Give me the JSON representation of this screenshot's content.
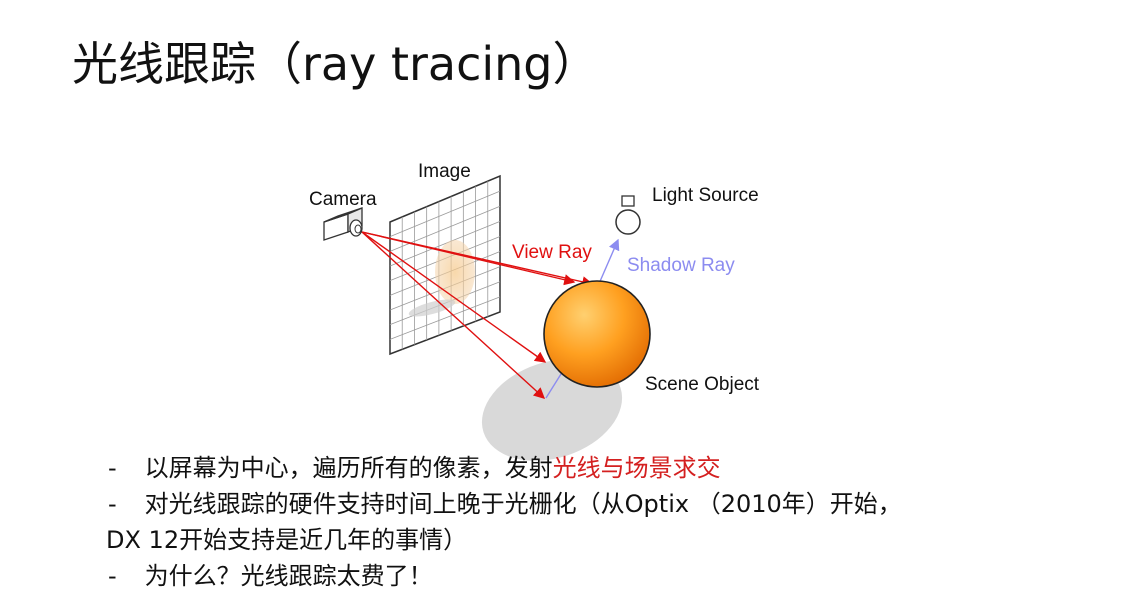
{
  "title": "光线跟踪（ray tracing）",
  "diagram": {
    "labels": {
      "camera": "Camera",
      "image": "Image",
      "light_source": "Light Source",
      "view_ray": "View Ray",
      "shadow_ray": "Shadow Ray",
      "scene_object": "Scene Object"
    },
    "colors": {
      "view_ray": "#e01010",
      "shadow_ray": "#8c8cf0",
      "sphere_light": "#ffb040",
      "sphere_dark": "#e07000",
      "shadow": "#d8d8d8"
    }
  },
  "bullets": [
    {
      "prefix": "-",
      "text": "以屏幕为中心，遍历所有的像素，发射",
      "highlight": "光线与场景求交"
    },
    {
      "prefix": "-",
      "text": "对光线跟踪的硬件支持时间上晚于光栅化（从Optix （2010年）开始，",
      "continuation": "DX 12开始支持是近几年的事情）"
    },
    {
      "prefix": "-",
      "text": "为什么？光线跟踪太费了！"
    }
  ]
}
